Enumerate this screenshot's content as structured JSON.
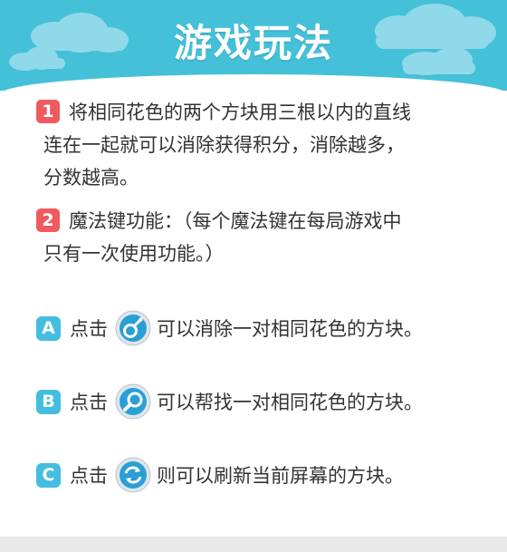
{
  "header": {
    "title": "游戏玩法"
  },
  "rules": [
    {
      "badge": "1",
      "lines": [
        "将相同花色的两个方块用三根以内的直线",
        "连在一起就可以消除获得积分，消除越多，",
        "分数越高。"
      ]
    },
    {
      "badge": "2",
      "lines": [
        "魔法键功能：（每个魔法键在每局游戏中",
        "只有一次使用功能。）"
      ]
    }
  ],
  "magic_keys": [
    {
      "badge": "A",
      "prefix": "点击",
      "icon": "bomb-icon",
      "text": "可以消除一对相同花色的方块。"
    },
    {
      "badge": "B",
      "prefix": "点击",
      "icon": "magnifier-icon",
      "text": "可以帮找一对相同花色的方块。"
    },
    {
      "badge": "C",
      "prefix": "点击",
      "icon": "refresh-icon",
      "text": "则可以刷新当前屏幕的方块。"
    }
  ],
  "colors": {
    "header": "#45c0d9",
    "number_badge": "#ef5a5e",
    "letter_badge": "#45bde0",
    "icon_blue": "#2a9fd6"
  }
}
